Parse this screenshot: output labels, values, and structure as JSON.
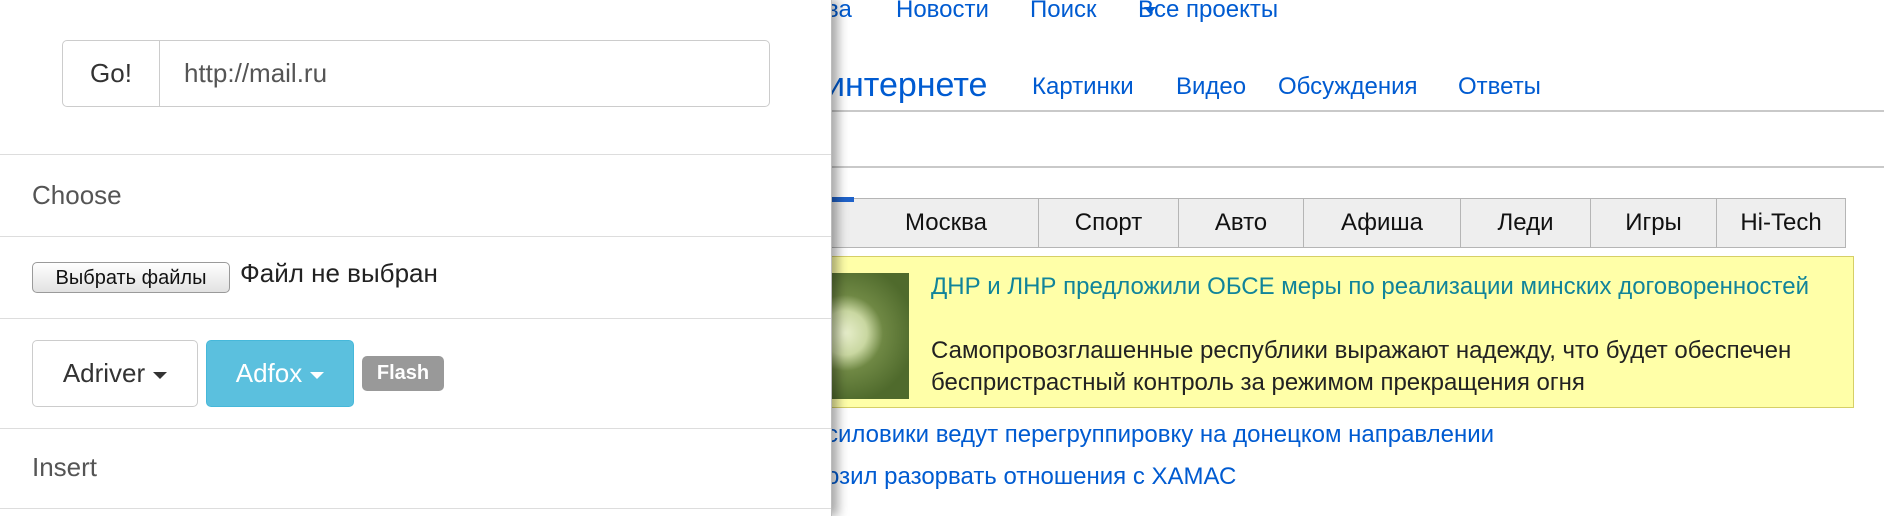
{
  "panel": {
    "go_label": "Go!",
    "url_value": "http://mail.ru",
    "choose_label": "Choose",
    "file_button_label": "Выбрать файлы",
    "file_status": "Файл не выбран",
    "adriver_label": "Adriver",
    "adfox_label": "Adfox",
    "flash_badge": "Flash",
    "insert_label": "Insert",
    "adfox_color": "#5bc0de",
    "flash_color": "#999999"
  },
  "background": {
    "top_nav": [
      "ва",
      "Новости",
      "Поиск",
      "Все проекты"
    ],
    "search_tabs": {
      "active": "интернете",
      "items": [
        "Картинки",
        "Видео",
        "Обсуждения",
        "Ответы"
      ]
    },
    "categories": [
      "Москва",
      "Спорт",
      "Авто",
      "Афиша",
      "Леди",
      "Игры",
      "Hi-Tech"
    ],
    "featured_news": {
      "title": "ДНР и ЛНР предложили ОБСЕ меры по реализации минских договоренностей",
      "text": "Самопровозглашенные республики выражают надежду, что будет обеспечен беспристрастный контроль за режимом прекращения огня"
    },
    "news_links": [
      "силовики ведут перегруппировку на донецком направлении",
      "озил разорвать отношения с ХАМАС"
    ],
    "link_color": "#005bd1",
    "highlight_color": "#ffffa8"
  }
}
